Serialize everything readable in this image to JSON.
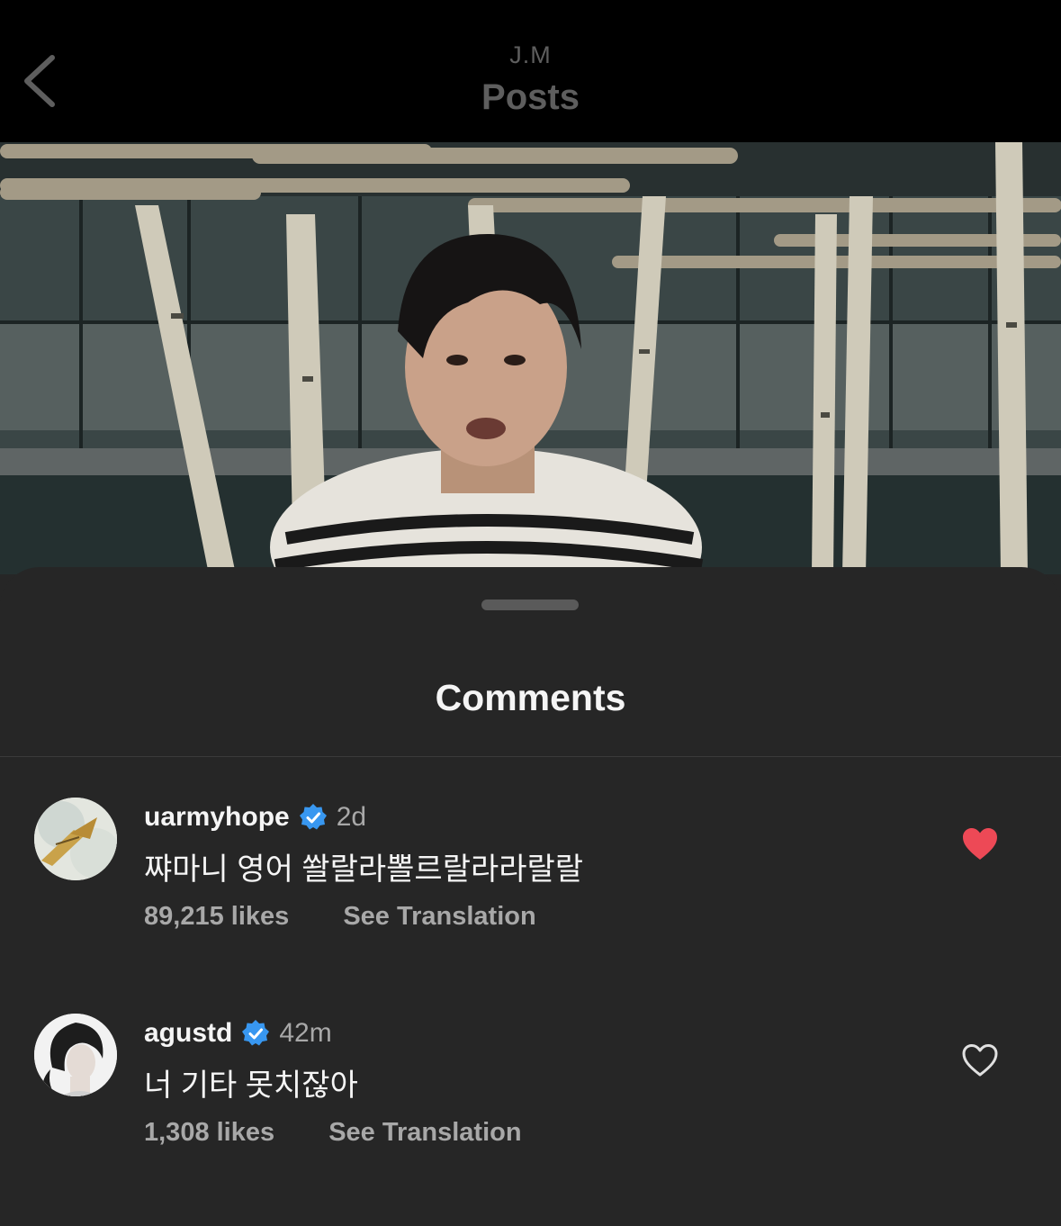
{
  "header": {
    "subtitle": "J.M",
    "title": "Posts",
    "back_icon": "chevron-left-icon"
  },
  "sheet": {
    "title": "Comments"
  },
  "comments": [
    {
      "username": "uarmyhope",
      "verified": true,
      "time": "2d",
      "text": "쨔마니 영어 쏼랄라뽈르랄라라랄랄",
      "likes": "89,215 likes",
      "see_translation": "See Translation",
      "liked": true
    },
    {
      "username": "agustd",
      "verified": true,
      "time": "42m",
      "text": "너 기타 못치잖아",
      "likes": "1,308 likes",
      "see_translation": "See Translation",
      "liked": false
    }
  ],
  "colors": {
    "verified_blue": "#3897f0",
    "like_red": "#ed4956",
    "sheet_bg": "#262626"
  }
}
